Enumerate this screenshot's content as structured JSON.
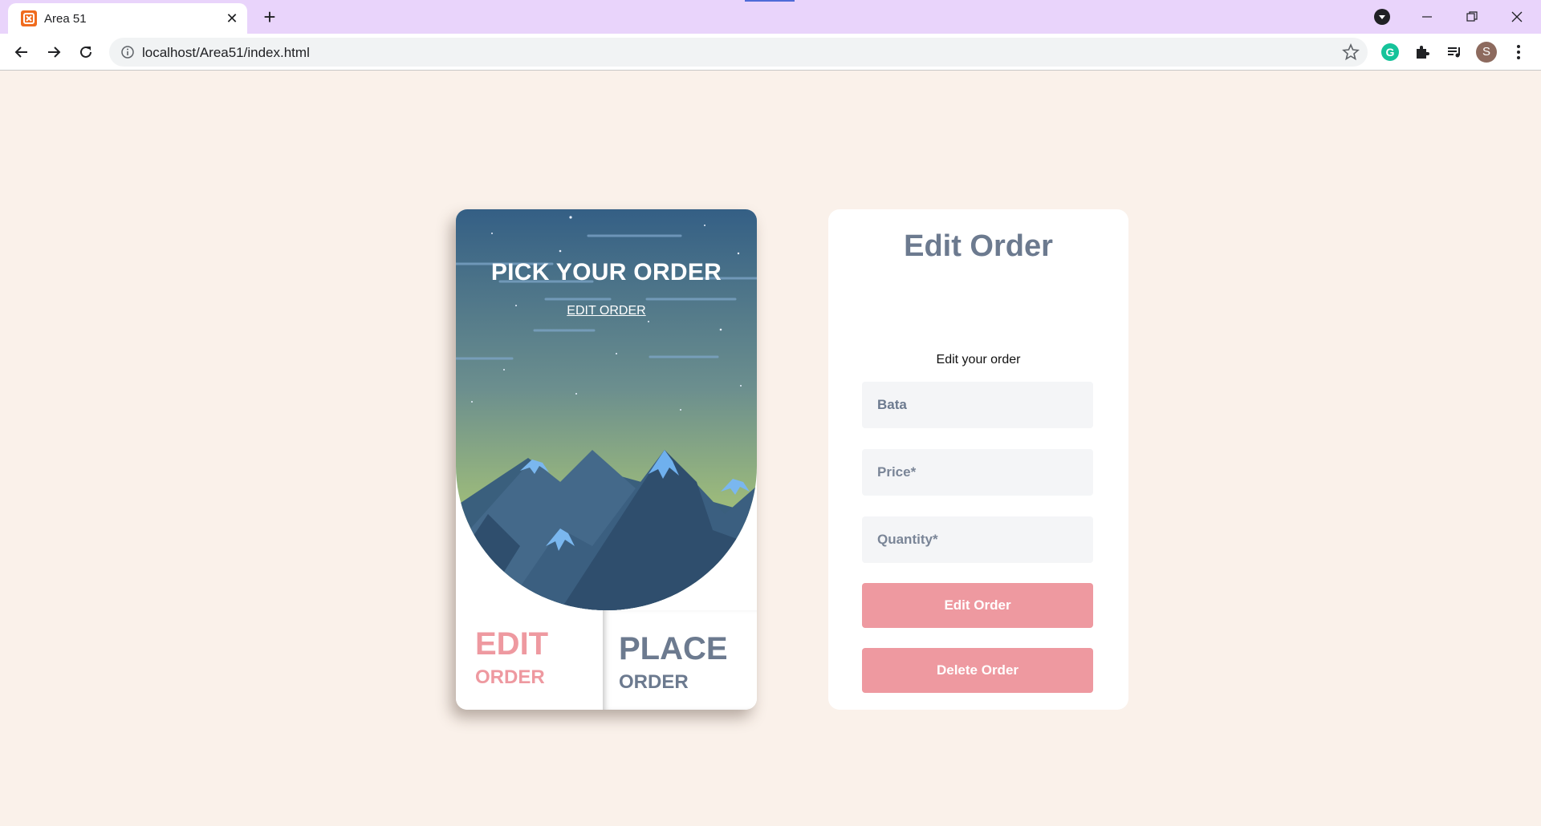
{
  "browser": {
    "tab_title": "Area 51",
    "tab_close_glyph": "✕",
    "new_tab_glyph": "+",
    "url": "localhost/Area51/index.html",
    "profile_initial": "S",
    "extension_initial": "G",
    "icons": [
      "app-favicon",
      "back-icon",
      "forward-icon",
      "reload-icon",
      "info-icon",
      "star-icon",
      "grammarly-icon",
      "puzzle-icon",
      "media-queue-icon",
      "kebab-menu-icon",
      "minimize-icon",
      "restore-icon",
      "close-icon"
    ]
  },
  "card": {
    "title": "PICK YOUR ORDER",
    "subtitle": "EDIT ORDER",
    "edit_big": "EDIT",
    "edit_small": "ORDER",
    "place_big": "PLACE",
    "place_small": "ORDER"
  },
  "form": {
    "title": "Edit Order",
    "caption": "Edit your order",
    "name_value": "Bata",
    "price_placeholder": "Price*",
    "quantity_placeholder": "Quantity*",
    "edit_button": "Edit Order",
    "delete_button": "Delete Order"
  },
  "colors": {
    "page_background": "#faf1ea",
    "accent_pink": "#ee99a0",
    "heading_slate": "#6c7a8f",
    "tabbar_lavender": "#e9d4fb"
  }
}
